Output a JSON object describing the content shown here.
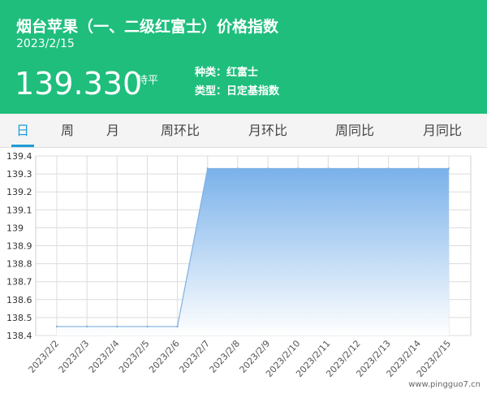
{
  "header": {
    "title": "烟台苹果（一、二级红富士）价格指数",
    "date": "2023/2/15",
    "price": "139.330",
    "trend": "持平",
    "variety": "种类：红富士",
    "index_type": "类型：日定基指数"
  },
  "tabs": [
    {
      "label": "日",
      "active": true
    },
    {
      "label": "周",
      "active": false
    },
    {
      "label": "月",
      "active": false
    },
    {
      "label": "周环比",
      "active": false
    },
    {
      "label": "月环比",
      "active": false
    },
    {
      "label": "周同比",
      "active": false
    },
    {
      "label": "月同比",
      "active": false
    }
  ],
  "chart_data": {
    "type": "area",
    "x": [
      "2023/2/2",
      "2023/2/3",
      "2023/2/4",
      "2023/2/5",
      "2023/2/6",
      "2023/2/7",
      "2023/2/8",
      "2023/2/9",
      "2023/2/10",
      "2023/2/11",
      "2023/2/12",
      "2023/2/13",
      "2023/2/14",
      "2023/2/15"
    ],
    "series": [
      {
        "values": [
          138.45,
          138.45,
          138.45,
          138.45,
          138.45,
          139.33,
          139.33,
          139.33,
          139.33,
          139.33,
          139.33,
          139.33,
          139.33,
          139.33
        ]
      }
    ],
    "yticks": [
      "139.4",
      "139.3",
      "139.2",
      "139.1",
      "139",
      "138.9",
      "138.8",
      "138.7",
      "138.6",
      "138.5",
      "138.4"
    ],
    "ylim": [
      138.4,
      139.4
    ],
    "grid": true,
    "colors": {
      "line": "#7fb0e2",
      "fill_top": "#7ab1ea",
      "fill_bottom": "#ffffff"
    }
  },
  "watermark": "www.pingguo7.cn"
}
